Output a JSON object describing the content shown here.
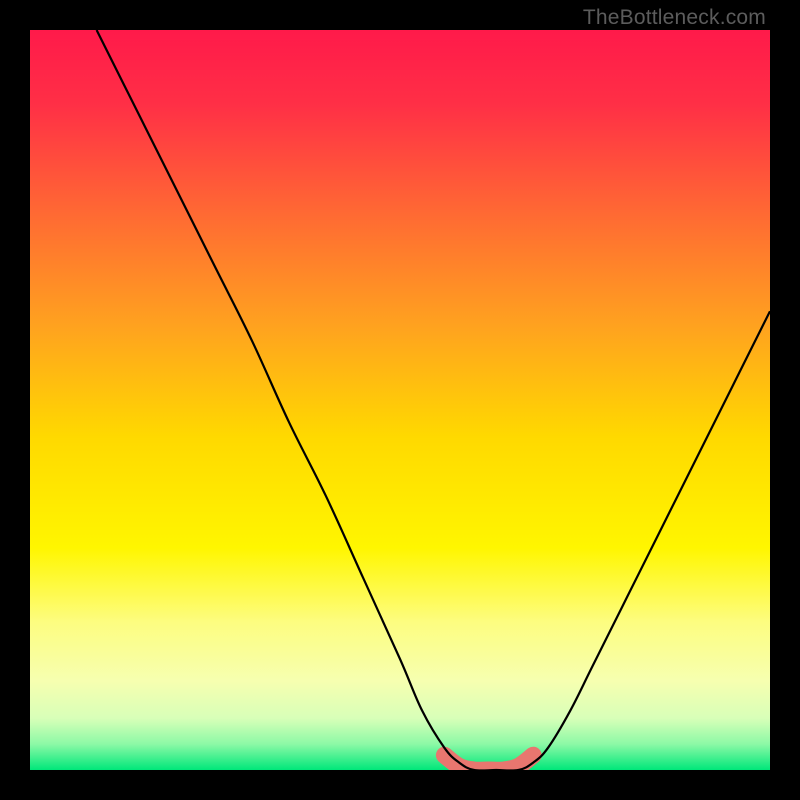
{
  "watermark": "TheBottleneck.com",
  "colors": {
    "frame": "#000000",
    "curve": "#000000",
    "highlight": "#e8766f",
    "gradient_stops": [
      {
        "offset": 0.0,
        "color": "#ff1a4a"
      },
      {
        "offset": 0.1,
        "color": "#ff2f46"
      },
      {
        "offset": 0.25,
        "color": "#ff6a33"
      },
      {
        "offset": 0.4,
        "color": "#ffa21f"
      },
      {
        "offset": 0.55,
        "color": "#ffd900"
      },
      {
        "offset": 0.7,
        "color": "#fff600"
      },
      {
        "offset": 0.8,
        "color": "#fdfd80"
      },
      {
        "offset": 0.88,
        "color": "#f6ffb0"
      },
      {
        "offset": 0.93,
        "color": "#d8ffb8"
      },
      {
        "offset": 0.965,
        "color": "#8cf9a6"
      },
      {
        "offset": 1.0,
        "color": "#00e77a"
      }
    ]
  },
  "chart_data": {
    "type": "line",
    "title": "",
    "xlabel": "",
    "ylabel": "",
    "xlim": [
      0,
      100
    ],
    "ylim": [
      0,
      100
    ],
    "grid": false,
    "description": "V-shaped bottleneck curve with a flat optimal valley. y represents bottleneck severity (0 at valley = optimal, ~100 at edges = severe). x covers the full plot width.",
    "series": [
      {
        "name": "bottleneck-curve",
        "x": [
          9,
          15,
          20,
          25,
          30,
          35,
          40,
          45,
          50,
          53,
          56,
          58,
          60,
          63,
          66,
          68,
          70,
          73,
          76,
          80,
          85,
          90,
          95,
          100
        ],
        "y": [
          100,
          88,
          78,
          68,
          58,
          47,
          37,
          26,
          15,
          8,
          3,
          1,
          0,
          0,
          0,
          1,
          3,
          8,
          14,
          22,
          32,
          42,
          52,
          62
        ]
      }
    ],
    "highlight": {
      "description": "Thick rounded pink segment marking the flat valley (optimal zone).",
      "x": [
        56,
        58,
        60,
        62,
        64,
        66,
        68
      ],
      "y": [
        2,
        0.5,
        0,
        0,
        0,
        0.5,
        2
      ]
    }
  }
}
